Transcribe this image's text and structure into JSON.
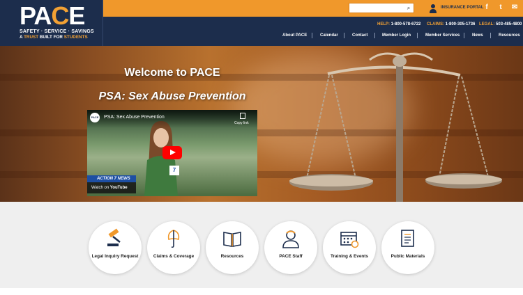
{
  "logo": {
    "text_main": "PA",
    "text_c": "C",
    "text_end": "E",
    "tagline1": "SAFETY · SERVICE · SAVINGS",
    "tagline2_a": "A ",
    "tagline2_b": "TRUST",
    "tagline2_c": " BUILT FOR ",
    "tagline2_d": "STUDENTS"
  },
  "topbar": {
    "search_placeholder": "",
    "search_icon": "magnifier-icon",
    "portal_icon": "user-icon",
    "portal_label": "INSURANCE PORTAL",
    "social": [
      {
        "name": "facebook-icon",
        "glyph": "f"
      },
      {
        "name": "twitter-icon",
        "glyph": "t"
      },
      {
        "name": "email-icon",
        "glyph": "✉"
      }
    ]
  },
  "contacts": {
    "help_label": "HELP:",
    "help_number": "1-800-578-6722",
    "claims_label": "CLAIMS:",
    "claims_number": "1-800-305-1736",
    "legal_label": "LEGAL:",
    "legal_number": "503-485-4800"
  },
  "nav": [
    "About PACE",
    "Calendar",
    "Contact",
    "Member Login",
    "Member Services",
    "News",
    "Resources"
  ],
  "hero": {
    "title": "Welcome to PACE",
    "subtitle": "PSA: Sex Abuse Prevention"
  },
  "video": {
    "channel": "PACE",
    "title": "PSA: Sex Abuse Prevention",
    "copy_label": "Copy link",
    "news_band": "ACTION 7 NEWS",
    "watch_on": "Watch on",
    "youtube": "YouTube",
    "mic_label": "7"
  },
  "quick_links": [
    {
      "label": "Legal Inquiry Request",
      "icon": "gavel-icon"
    },
    {
      "label": "Claims & Coverage",
      "icon": "umbrella-icon"
    },
    {
      "label": "Resources",
      "icon": "book-icon"
    },
    {
      "label": "PACE Staff",
      "icon": "staff-icon"
    },
    {
      "label": "Training & Events",
      "icon": "calendar-icon"
    },
    {
      "label": "Public Materials",
      "icon": "document-icon"
    }
  ],
  "colors": {
    "navy": "#1c2d4c",
    "orange": "#f0982b",
    "accent": "#f2a134"
  }
}
